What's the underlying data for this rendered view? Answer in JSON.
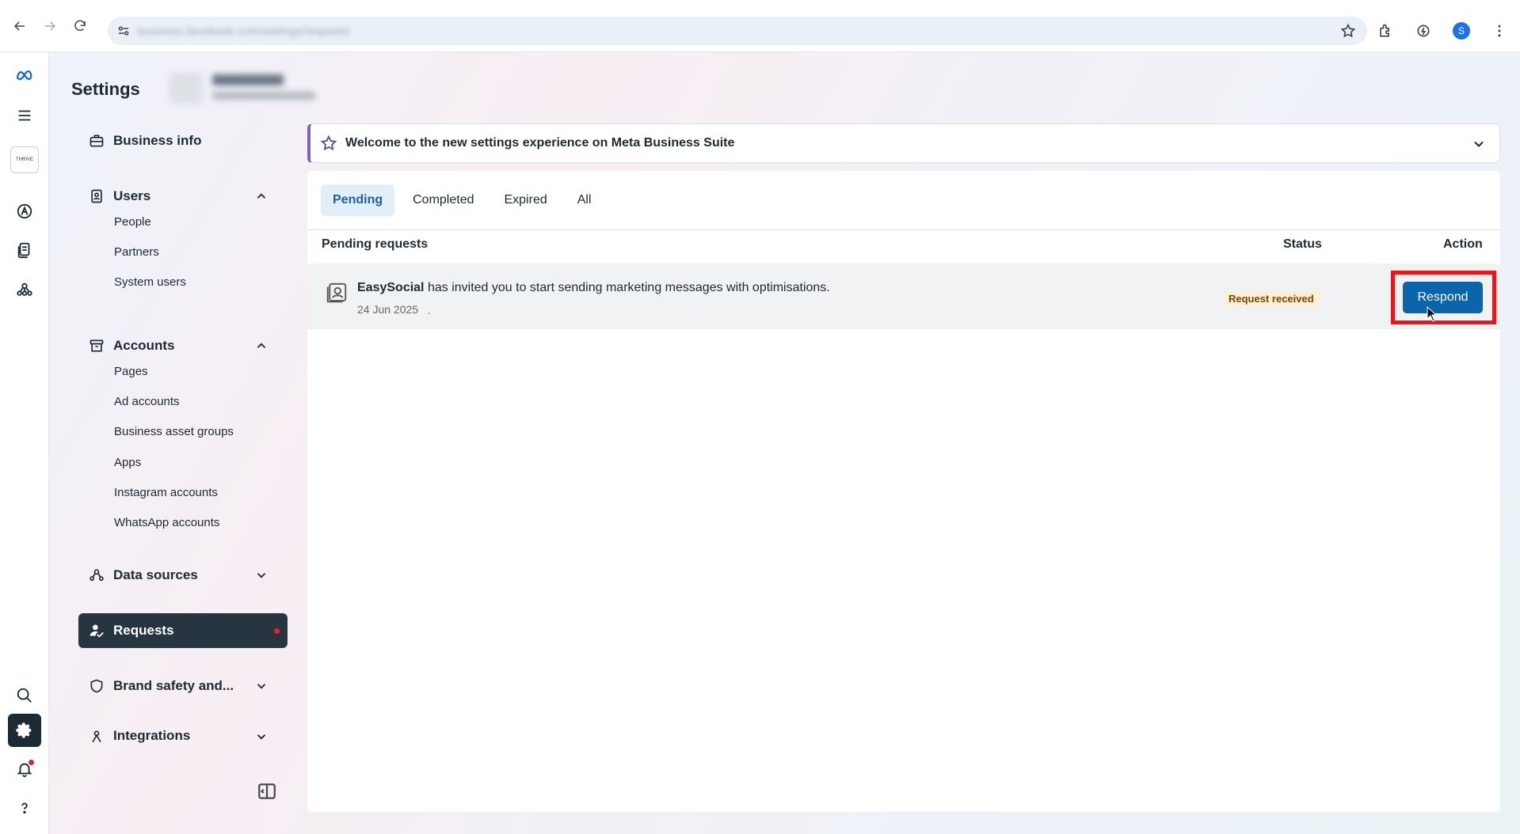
{
  "browser": {
    "url": "business.facebook.com/settings/requests",
    "profile_initial": "S"
  },
  "app": {
    "settings_title": "Settings",
    "business_logo_text": "THRIVE"
  },
  "sidebar": {
    "business_info": "Business info",
    "users": {
      "label": "Users",
      "items": [
        "People",
        "Partners",
        "System users"
      ]
    },
    "accounts": {
      "label": "Accounts",
      "items": [
        "Pages",
        "Ad accounts",
        "Business asset groups",
        "Apps",
        "Instagram accounts",
        "WhatsApp accounts"
      ]
    },
    "data_sources": "Data sources",
    "requests": "Requests",
    "brand_safety": "Brand safety and...",
    "integrations": "Integrations"
  },
  "banner": {
    "text": "Welcome to the new settings experience on Meta Business Suite"
  },
  "tabs": [
    "Pending",
    "Completed",
    "Expired",
    "All"
  ],
  "table": {
    "headers": {
      "requests": "Pending requests",
      "status": "Status",
      "action": "Action"
    },
    "rows": [
      {
        "company": "EasySocial",
        "message": " has invited you to start sending marketing messages with optimisations.",
        "date": "24 Jun 2025",
        "separator": ".",
        "status": "Request received",
        "action": "Respond"
      }
    ]
  },
  "colors": {
    "primary_button": "#0c64aa",
    "highlight_border": "#e8151b",
    "active_nav": "#273540",
    "banner_accent": "#7b61c4"
  }
}
